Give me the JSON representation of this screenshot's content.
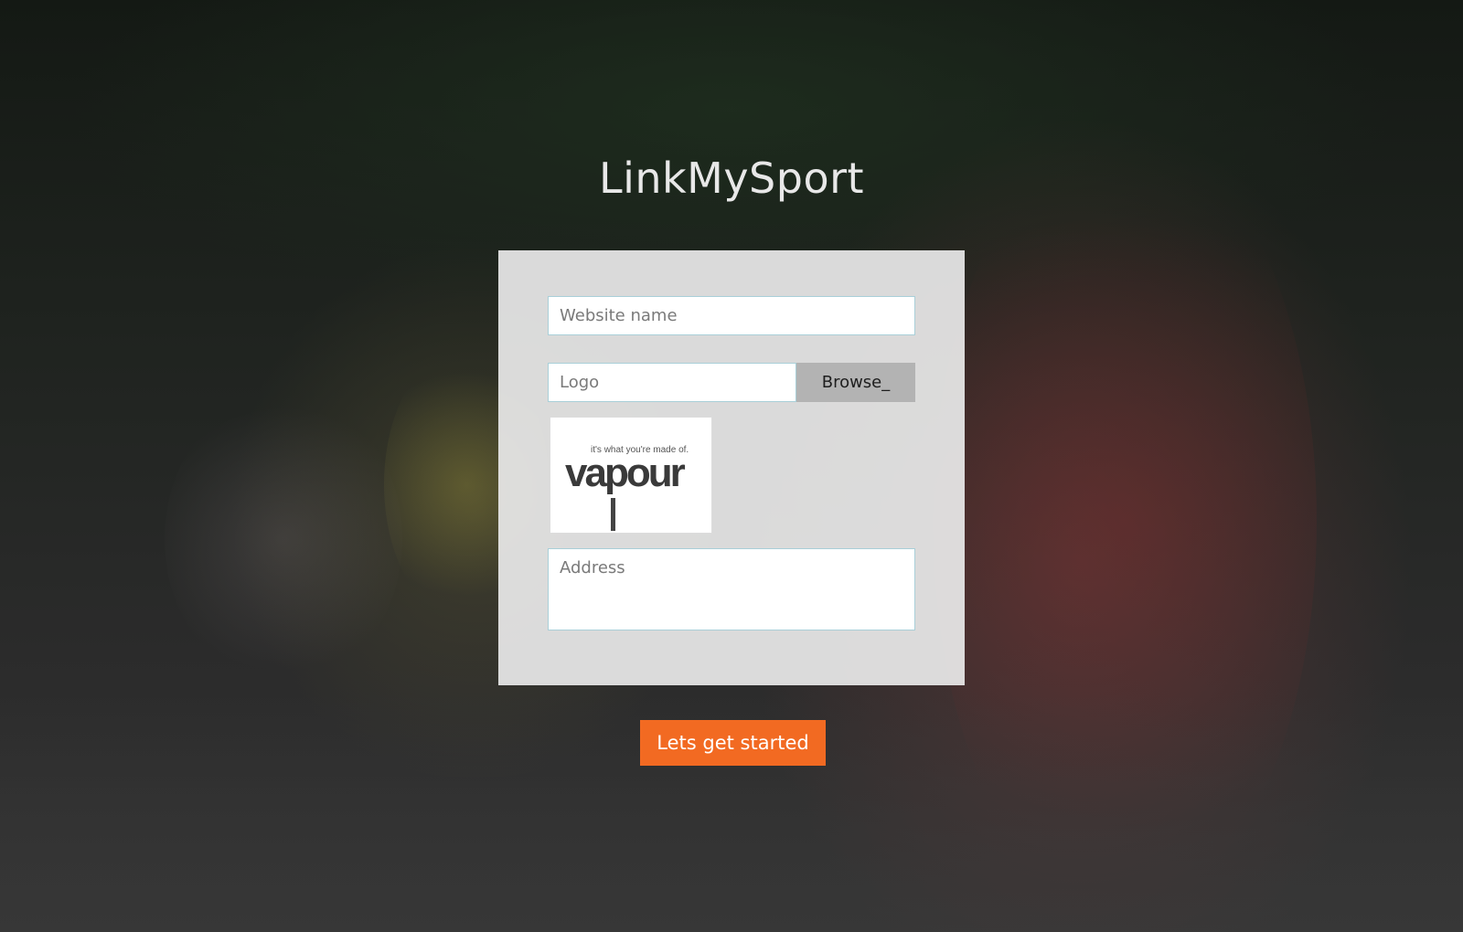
{
  "app": {
    "title": "LinkMySport"
  },
  "form": {
    "website_name": {
      "placeholder": "Website name",
      "value": ""
    },
    "logo": {
      "placeholder": "Logo",
      "value": "",
      "browse_label": "Browse_",
      "preview": {
        "tagline": "it's what you're made of.",
        "word": "vapour"
      }
    },
    "address": {
      "placeholder": "Address",
      "value": ""
    },
    "submit_label": "Lets get started"
  },
  "colors": {
    "accent": "#f26a22",
    "card_background": "#e8e8e8",
    "browse_button": "#b3b3b3",
    "field_border": "#a9cfd8"
  }
}
